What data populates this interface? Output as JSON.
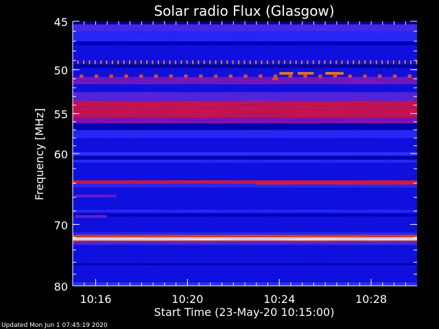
{
  "chart_data": {
    "type": "heatmap",
    "title": "Solar radio Flux (Glasgow)",
    "xlabel": "Start Time (23-May-20 10:15:00)",
    "ylabel": "Frequency [MHz]",
    "footer": "Updated Mon Jun  1 07:45:19 2020",
    "x_range_minutes": [
      0,
      15.0
    ],
    "x_tick_labels": [
      {
        "label": "10:16",
        "minute": 1
      },
      {
        "label": "10:20",
        "minute": 5
      },
      {
        "label": "10:24",
        "minute": 9
      },
      {
        "label": "10:28",
        "minute": 13
      }
    ],
    "y_range_mhz": [
      45,
      80
    ],
    "y_tick_labels": [
      {
        "label": "45",
        "mhz": 45
      },
      {
        "label": "50",
        "mhz": 50
      },
      {
        "label": "55",
        "mhz": 55
      },
      {
        "label": "60",
        "mhz": 60
      },
      {
        "label": "70",
        "mhz": 70
      },
      {
        "label": "80",
        "mhz": 80
      }
    ],
    "y_ticks_all_mhz": [
      45,
      46,
      47,
      48,
      49,
      50,
      51,
      52,
      53,
      54,
      55,
      56,
      57,
      58,
      59,
      60,
      62,
      64,
      66,
      68,
      70,
      72,
      74,
      76,
      78,
      80
    ],
    "x_ticks_minor_minutes": [
      0,
      0.5,
      1,
      1.5,
      2,
      2.5,
      3,
      3.5,
      4,
      4.5,
      5,
      5.5,
      6,
      6.5,
      7,
      7.5,
      8,
      8.5,
      9,
      9.5,
      10,
      10.5,
      11,
      11.5,
      12,
      12.5,
      13,
      13.5,
      14,
      14.5
    ],
    "colormap": [
      "#00003c",
      "#0000c8",
      "#3a3aff",
      "#c8006a",
      "#ff3000",
      "#ffb400",
      "#ffffff"
    ],
    "background_intensity": 0.22,
    "bands": [
      {
        "mhz_start": 45.0,
        "mhz_end": 45.3,
        "intensity": 0.05
      },
      {
        "mhz_start": 45.3,
        "mhz_end": 46.0,
        "intensity": 0.36
      },
      {
        "mhz_start": 46.0,
        "mhz_end": 47.0,
        "intensity": 0.3
      },
      {
        "mhz_start": 47.0,
        "mhz_end": 47.4,
        "intensity": 0.14
      },
      {
        "mhz_start": 49.4,
        "mhz_end": 49.8,
        "intensity": 0.1
      },
      {
        "mhz_start": 50.8,
        "mhz_end": 51.6,
        "intensity": 0.42
      },
      {
        "mhz_start": 52.5,
        "mhz_end": 53.5,
        "intensity": 0.38
      },
      {
        "mhz_start": 53.5,
        "mhz_end": 55.5,
        "intensity": 0.58
      },
      {
        "mhz_start": 55.5,
        "mhz_end": 56.2,
        "intensity": 0.44
      },
      {
        "mhz_start": 56.2,
        "mhz_end": 57.0,
        "intensity": 0.12
      },
      {
        "mhz_start": 57.0,
        "mhz_end": 58.0,
        "intensity": 0.3
      },
      {
        "mhz_start": 59.8,
        "mhz_end": 60.3,
        "intensity": 0.32
      },
      {
        "mhz_start": 60.3,
        "mhz_end": 60.8,
        "intensity": 0.12
      },
      {
        "mhz_start": 60.8,
        "mhz_end": 61.2,
        "intensity": 0.3
      },
      {
        "mhz_start": 63.6,
        "mhz_end": 64.1,
        "intensity": 0.6
      },
      {
        "mhz_start": 64.1,
        "mhz_end": 64.6,
        "intensity": 0.3
      },
      {
        "mhz_start": 67.8,
        "mhz_end": 68.2,
        "intensity": 0.3
      },
      {
        "mhz_start": 68.4,
        "mhz_end": 68.8,
        "intensity": 0.14
      },
      {
        "mhz_start": 71.2,
        "mhz_end": 71.6,
        "intensity": 0.3
      },
      {
        "mhz_start": 71.6,
        "mhz_end": 72.0,
        "intensity": 0.7
      },
      {
        "mhz_start": 72.0,
        "mhz_end": 72.5,
        "intensity": 0.98
      },
      {
        "mhz_start": 72.5,
        "mhz_end": 72.8,
        "intensity": 0.62
      },
      {
        "mhz_start": 72.8,
        "mhz_end": 73.2,
        "intensity": 0.32
      },
      {
        "mhz_start": 76.2,
        "mhz_end": 76.5,
        "intensity": 0.12
      },
      {
        "mhz_start": 79.4,
        "mhz_end": 80.0,
        "intensity": 0.32
      }
    ],
    "events": [
      {
        "minute_start": 0.1,
        "minute_end": 1.9,
        "mhz": 65.8,
        "intensity": 0.4
      },
      {
        "minute_start": 0.1,
        "minute_end": 1.5,
        "mhz": 68.8,
        "intensity": 0.4
      },
      {
        "minute_start": 8.0,
        "minute_end": 15.0,
        "mhz": 64.0,
        "intensity": 0.62
      },
      {
        "minute_start": 8.7,
        "minute_end": 8.95,
        "mhz": 51.0,
        "intensity": 0.72
      },
      {
        "minute_start": 9.0,
        "minute_end": 9.6,
        "mhz": 50.4,
        "intensity": 0.78
      },
      {
        "minute_start": 9.8,
        "minute_end": 10.5,
        "mhz": 50.4,
        "intensity": 0.78
      },
      {
        "minute_start": 11.0,
        "minute_end": 11.8,
        "mhz": 50.4,
        "intensity": 0.78
      }
    ],
    "periodic_markers": [
      {
        "mhz": 49.2,
        "minute_start": 0.2,
        "minute_end": 15.0,
        "spacing_minutes": 0.25,
        "width_minutes": 0.06,
        "height_mhz": 0.4,
        "intensity": 0.8
      },
      {
        "mhz": 50.7,
        "minute_start": 0.3,
        "minute_end": 15.0,
        "spacing_minutes": 0.65,
        "width_minutes": 0.16,
        "height_mhz": 0.35,
        "intensity": 0.72
      }
    ]
  }
}
